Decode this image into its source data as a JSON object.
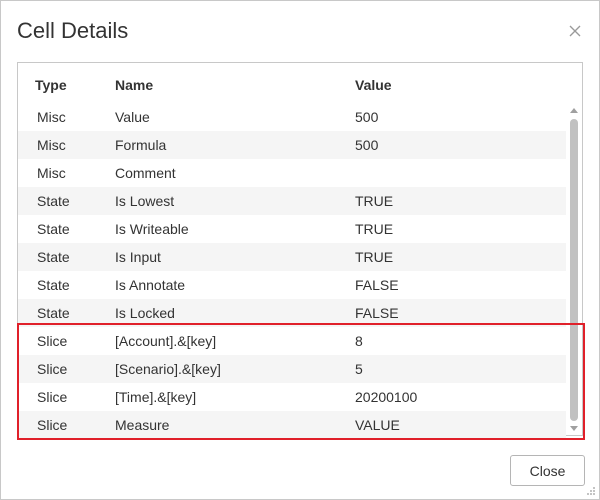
{
  "dialog": {
    "title": "Cell Details",
    "close_icon": "close-icon",
    "close_button_label": "Close"
  },
  "table": {
    "columns": [
      "Type",
      "Name",
      "Value"
    ],
    "rows": [
      {
        "type": "Misc",
        "name": "Value",
        "value": "500"
      },
      {
        "type": "Misc",
        "name": "Formula",
        "value": "500"
      },
      {
        "type": "Misc",
        "name": "Comment",
        "value": ""
      },
      {
        "type": "State",
        "name": "Is Lowest",
        "value": "TRUE"
      },
      {
        "type": "State",
        "name": "Is Writeable",
        "value": "TRUE"
      },
      {
        "type": "State",
        "name": "Is Input",
        "value": "TRUE"
      },
      {
        "type": "State",
        "name": "Is Annotate",
        "value": "FALSE"
      },
      {
        "type": "State",
        "name": "Is Locked",
        "value": "FALSE"
      },
      {
        "type": "Slice",
        "name": "[Account].&[key]",
        "value": "8"
      },
      {
        "type": "Slice",
        "name": "[Scenario].&[key]",
        "value": "5"
      },
      {
        "type": "Slice",
        "name": "[Time].&[key]",
        "value": "20200100"
      },
      {
        "type": "Slice",
        "name": "Measure",
        "value": "VALUE"
      }
    ]
  },
  "colors": {
    "highlight": "#e0202a",
    "row_alt": "#f5f5f5"
  }
}
